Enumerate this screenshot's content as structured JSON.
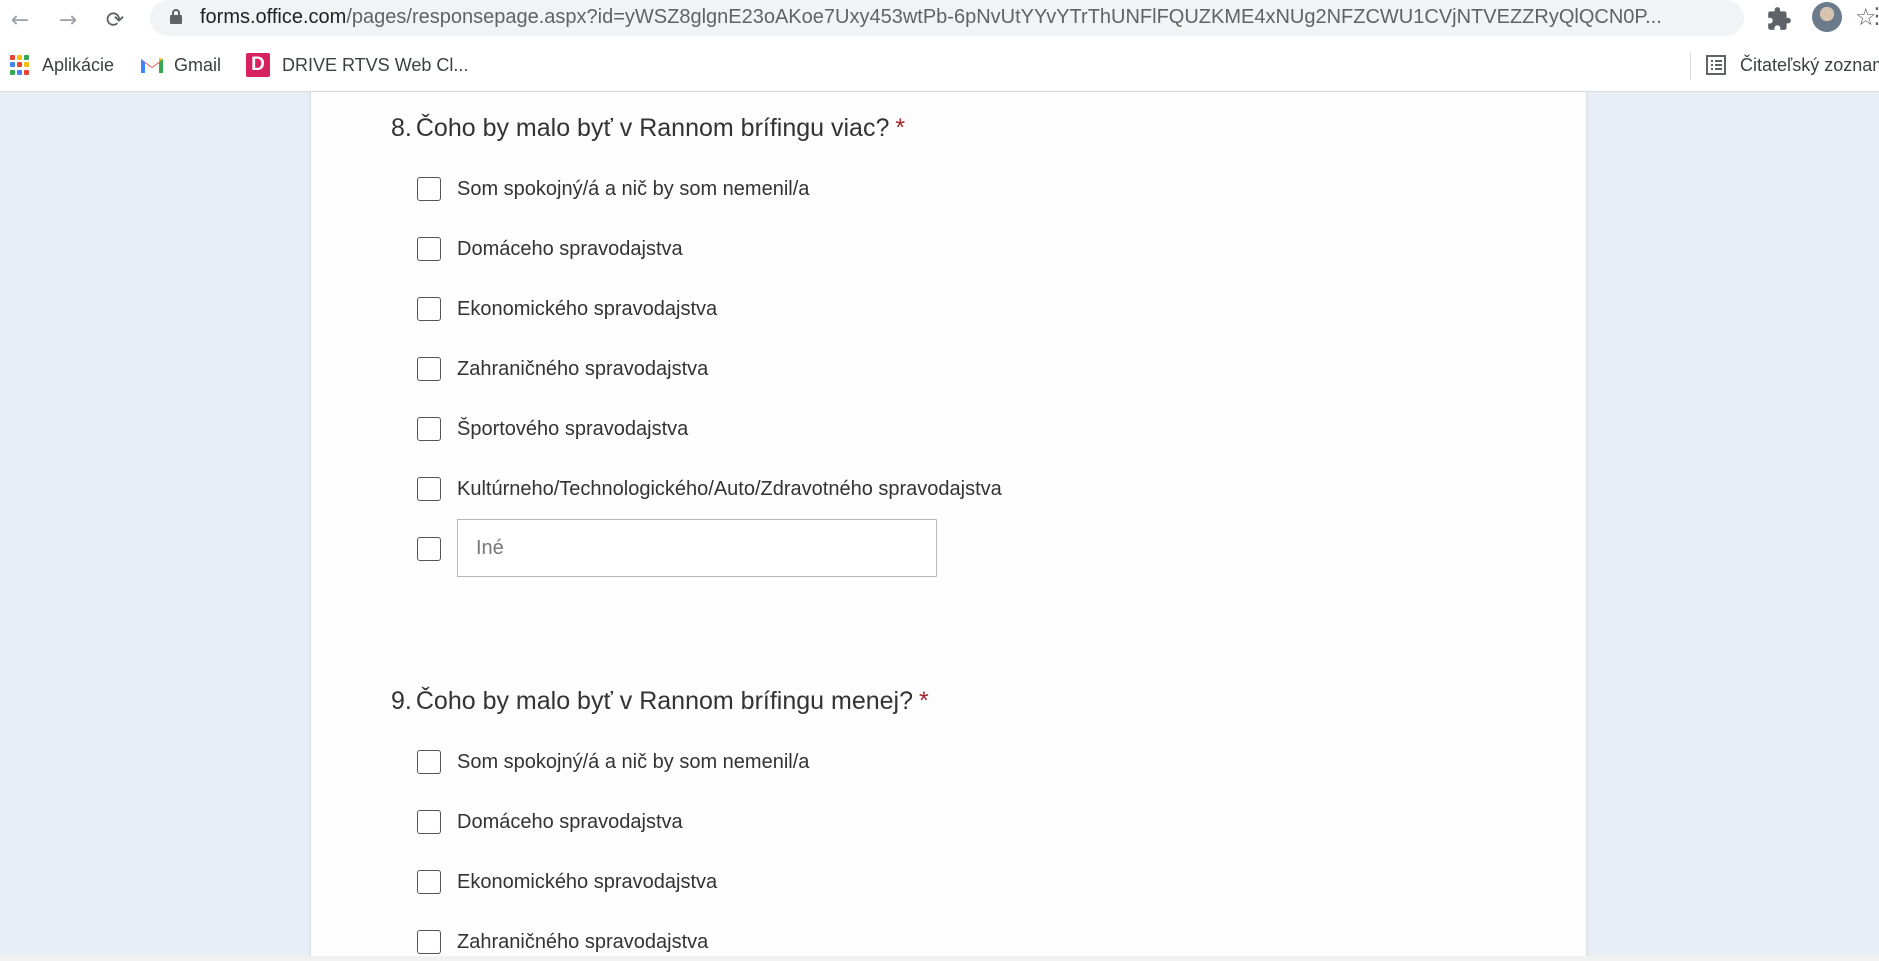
{
  "browser": {
    "url_host": "forms.office.com",
    "url_rest": "/pages/responsepage.aspx?id=yWSZ8glgnE23oAKoe7Uxy453wtPb-6pNvUtYYvYTrThUNFlFQUZKME4xNUg2NFZCWU1CVjNTVEZZRyQlQCN0P...",
    "bookmarks": [
      {
        "label": "Aplikácie",
        "icon": "apps-grid-icon"
      },
      {
        "label": "Gmail",
        "icon": "gmail-icon"
      },
      {
        "label": "DRIVE RTVS Web Cl...",
        "icon": "drive-d-icon"
      }
    ],
    "reading_list_label": "Čitateľský zoznam"
  },
  "form": {
    "questions": [
      {
        "number": "8.",
        "title": "Čoho by malo byť v Rannom brífingu viac?",
        "required_mark": "*",
        "options": [
          "Som spokojný/á a nič by som nemenil/a",
          "Domáceho spravodajstva",
          "Ekonomického spravodajstva",
          "Zahraničného spravodajstva",
          "Športového spravodajstva",
          "Kultúrneho/Technologického/Auto/Zdravotného spravodajstva"
        ],
        "other_placeholder": "Iné"
      },
      {
        "number": "9.",
        "title": "Čoho by malo byť v Rannom brífingu menej?",
        "required_mark": "*",
        "options": [
          "Som spokojný/á a nič by som nemenil/a",
          "Domáceho spravodajstva",
          "Ekonomického spravodajstva",
          "Zahraničného spravodajstva"
        ]
      }
    ]
  },
  "colors": {
    "required": "#a4262c",
    "page_background": "#e9eef6",
    "card_background": "#fdfdfd"
  }
}
